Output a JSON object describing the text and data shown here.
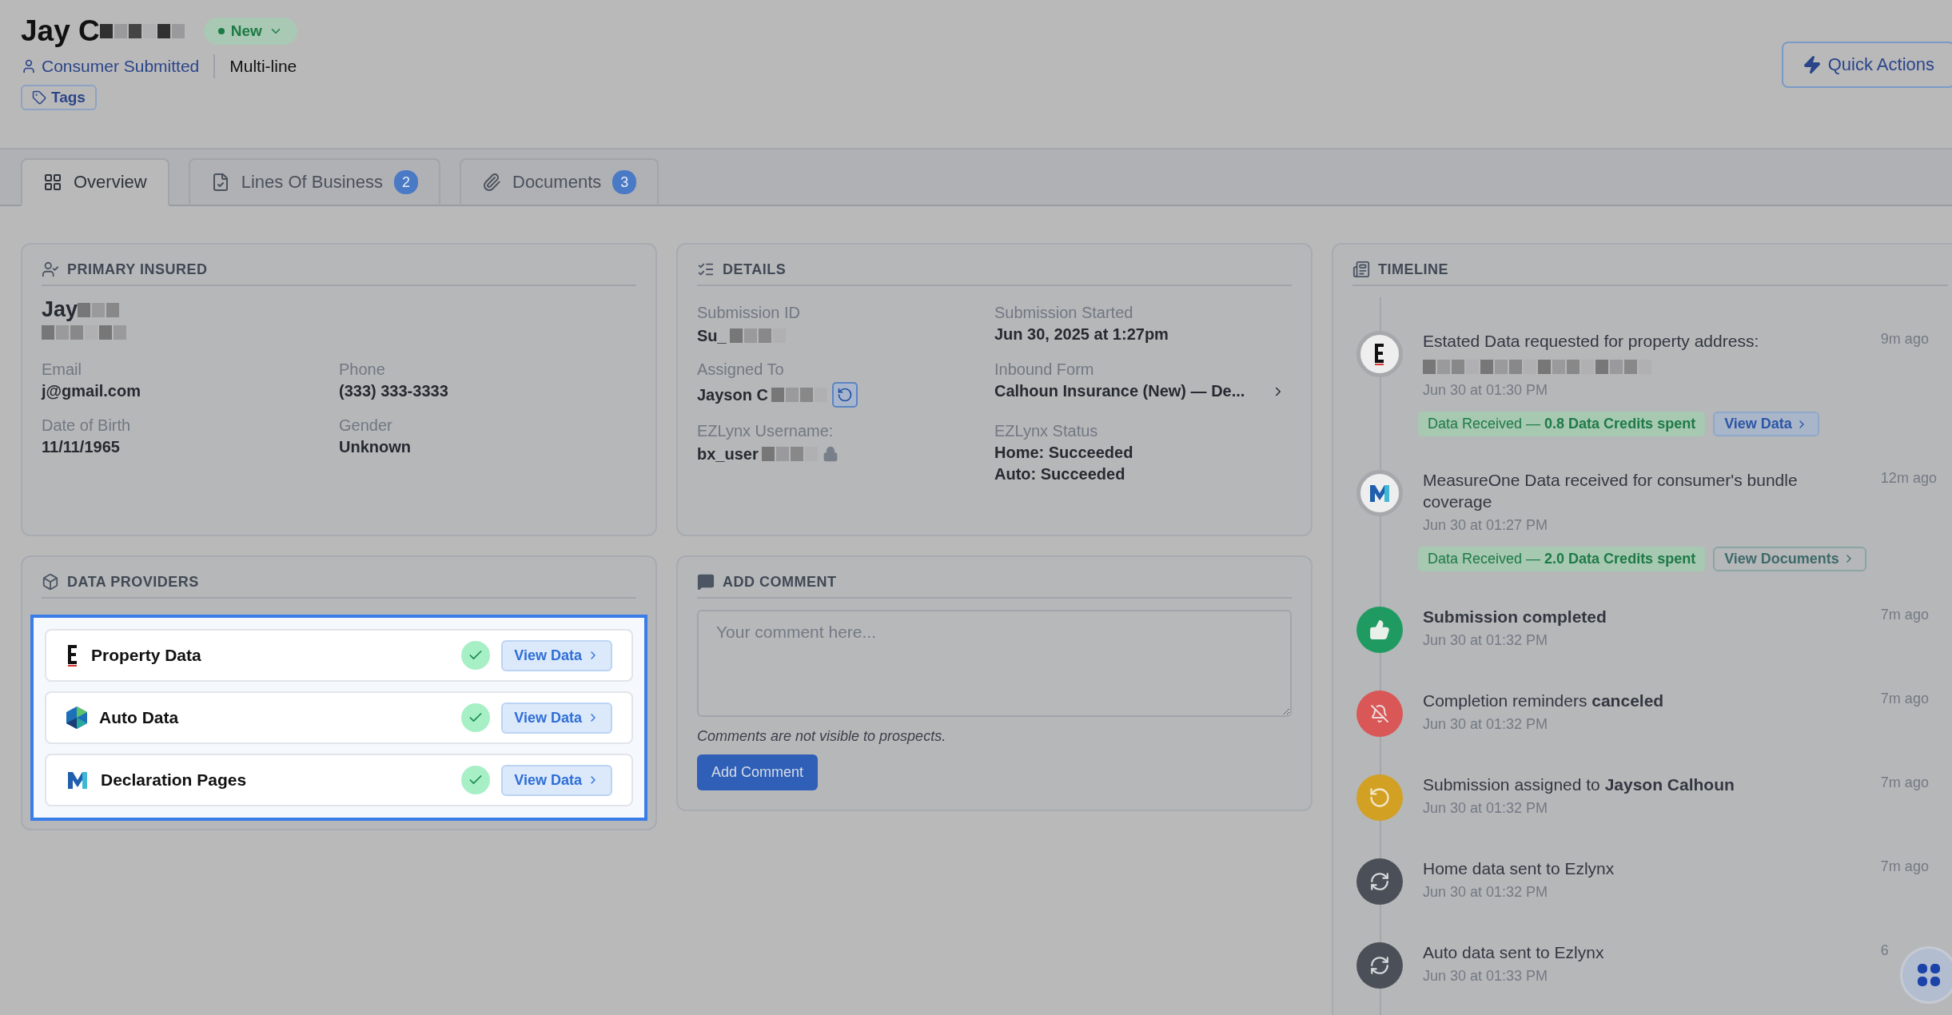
{
  "header": {
    "name": "Jay C",
    "name_redacted": true,
    "status": "New",
    "source": "Consumer Submitted",
    "type": "Multi-line",
    "tags_button": "Tags",
    "quick_actions": "Quick Actions"
  },
  "tabs": [
    {
      "label": "Overview",
      "selected": true
    },
    {
      "label": "Lines Of Business",
      "count": "2",
      "selected": false
    },
    {
      "label": "Documents",
      "count": "3",
      "selected": false
    }
  ],
  "primary_insured": {
    "title": "PRIMARY INSURED",
    "name": "Jay",
    "name_redacted": true,
    "subtitle_redacted": true,
    "fields": [
      {
        "label": "Email",
        "value": "j@gmail.com"
      },
      {
        "label": "Phone",
        "value": "(333) 333-3333"
      },
      {
        "label": "Date of Birth",
        "value": "11/11/1965"
      },
      {
        "label": "Gender",
        "value": "Unknown"
      }
    ]
  },
  "details": {
    "title": "DETAILS",
    "fields": [
      {
        "label": "Submission ID",
        "lines": [
          "Su_"
        ],
        "redacted": true,
        "kind": "plain"
      },
      {
        "label": "Submission Started",
        "lines": [
          "Jun 30, 2025 at 1:27pm"
        ],
        "kind": "plain"
      },
      {
        "label": "Assigned To",
        "lines": [
          "Jayson C"
        ],
        "redacted": true,
        "kind": "reassign"
      },
      {
        "label": "Inbound Form",
        "lines": [
          "Calhoun Insurance (New) — De..."
        ],
        "kind": "link"
      },
      {
        "label": "EZLynx Username:",
        "lines": [
          "bx_user"
        ],
        "redacted": true,
        "kind": "locked"
      },
      {
        "label": "EZLynx Status",
        "lines": [
          "Home: Succeeded",
          "Auto: Succeeded"
        ],
        "kind": "plain"
      }
    ]
  },
  "data_providers": {
    "title": "DATA PROVIDERS",
    "highlighted": true,
    "items": [
      {
        "name": "Property Data",
        "kind": "estated",
        "checked": true,
        "button": "View Data"
      },
      {
        "name": "Auto Data",
        "kind": "hexagon",
        "checked": true,
        "button": "View Data"
      },
      {
        "name": "Declaration Pages",
        "kind": "measureone",
        "checked": true,
        "button": "View Data"
      }
    ]
  },
  "comment": {
    "title": "ADD COMMENT",
    "placeholder": "Your comment here...",
    "note": "Comments are not visible to prospects.",
    "button": "Add Comment"
  },
  "timeline": {
    "title": "TIMELINE",
    "events": [
      {
        "kind": "estated",
        "text": "Estated Data requested for property address:",
        "bold": false,
        "redacted_line": true,
        "date": "Jun 30 at 01:30 PM",
        "ago": "9m ago",
        "badge": "Data Received — **0.8 Data Credits spent**",
        "action": {
          "label": "View Data",
          "kind": "filled"
        }
      },
      {
        "kind": "measureone",
        "text": "MeasureOne Data received for consumer's bundle coverage",
        "bold": false,
        "date": "Jun 30 at 01:27 PM",
        "ago": "12m ago",
        "badge": "Data Received — **2.0 Data Credits spent**",
        "action": {
          "label": "View Documents",
          "kind": "outline"
        }
      },
      {
        "kind": "completed",
        "text": "Submission completed",
        "bold": true,
        "date": "Jun 30 at 01:32 PM",
        "ago": "7m ago"
      },
      {
        "kind": "canceled",
        "text": "Completion reminders **canceled**",
        "bold": false,
        "date": "Jun 30 at 01:32 PM",
        "ago": "7m ago"
      },
      {
        "kind": "assigned",
        "text": "Submission assigned to **Jayson Calhoun**",
        "bold": false,
        "date": "Jun 30 at 01:32 PM",
        "ago": "7m ago"
      },
      {
        "kind": "sync",
        "text": "Home data sent to Ezlynx",
        "bold": false,
        "date": "Jun 30 at 01:32 PM",
        "ago": "7m ago"
      },
      {
        "kind": "sync",
        "text": "Auto data sent to Ezlynx",
        "bold": false,
        "date": "Jun 30 at 01:33 PM",
        "ago": "6"
      }
    ]
  }
}
